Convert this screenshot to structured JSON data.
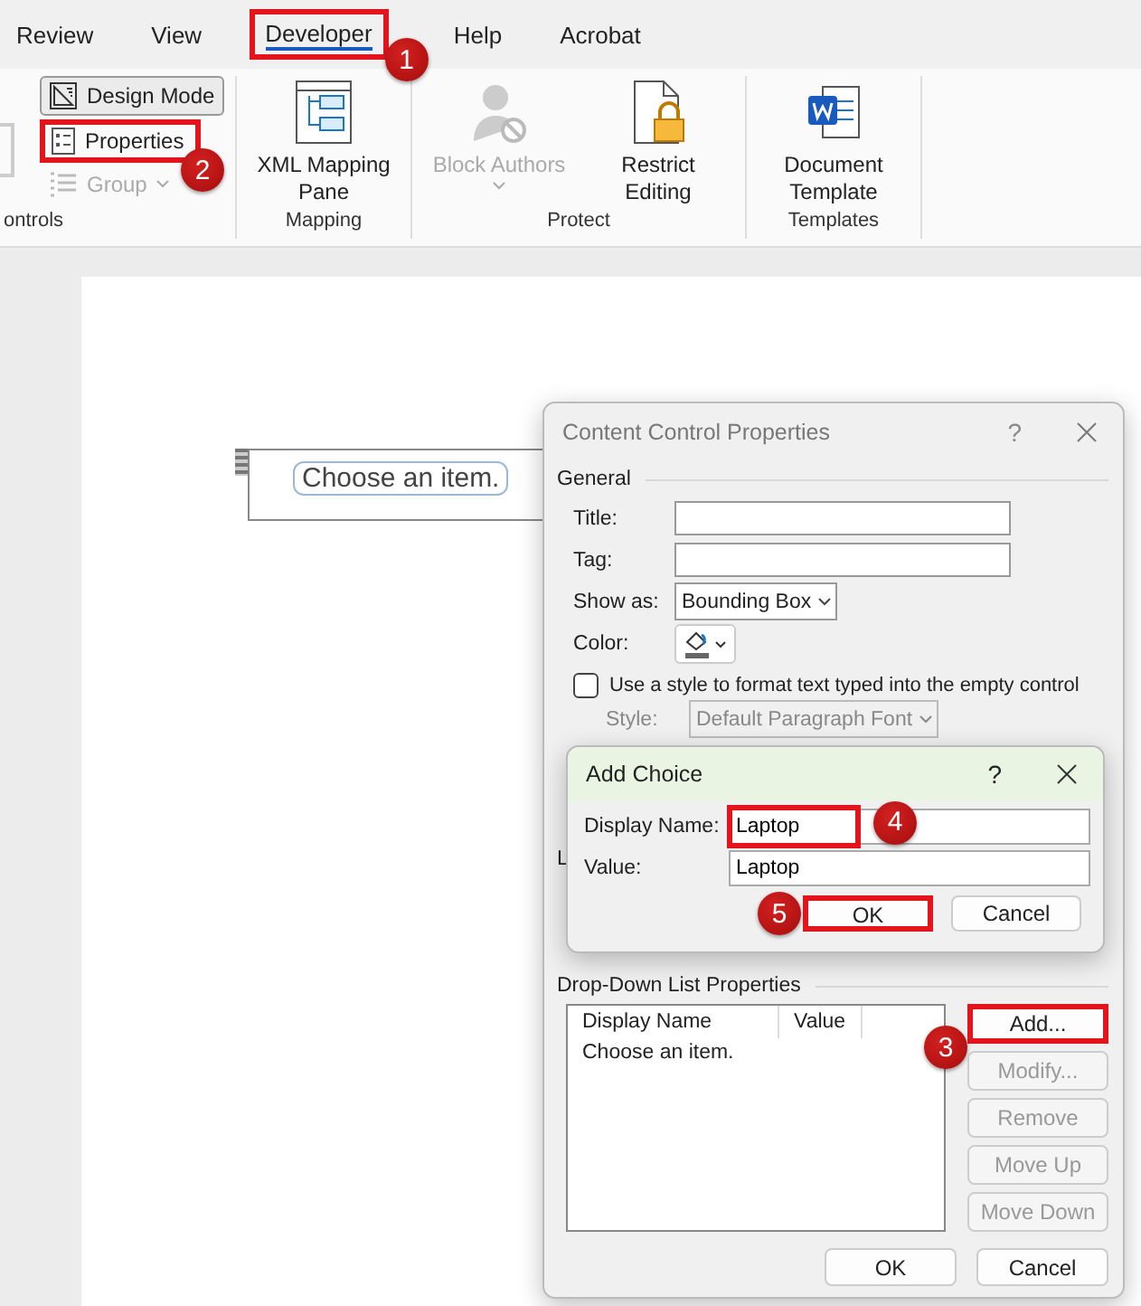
{
  "ribbon_tabs": [
    {
      "label": "Review",
      "selected": false
    },
    {
      "label": "View",
      "selected": false
    },
    {
      "label": "Developer",
      "selected": true,
      "callout": "1"
    },
    {
      "label": "Help",
      "selected": false
    },
    {
      "label": "Acrobat",
      "selected": false
    }
  ],
  "ribbon_groups": [
    {
      "label": "ontrols",
      "kind": "small",
      "buttons": [
        {
          "label": "Design Mode",
          "pressed": true,
          "disabled": false
        },
        {
          "label": "Properties",
          "pressed": false,
          "disabled": false,
          "callout": "2"
        },
        {
          "label": "Group",
          "pressed": false,
          "disabled": true,
          "dropdown": true
        }
      ]
    },
    {
      "label": "Mapping",
      "kind": "large",
      "buttons": [
        {
          "label": "XML Mapping Pane",
          "disabled": false
        }
      ]
    },
    {
      "label": "Protect",
      "kind": "large",
      "buttons": [
        {
          "label": "Block Authors",
          "disabled": true,
          "dropdown": true
        },
        {
          "label": "Restrict Editing",
          "disabled": false
        }
      ]
    },
    {
      "label": "Templates",
      "kind": "large",
      "buttons": [
        {
          "label": "Document Template",
          "disabled": false
        }
      ]
    }
  ],
  "document": {
    "content_control_text": "Choose an item."
  },
  "properties_dialog": {
    "title": "Content Control Properties",
    "help": "?",
    "general_heading": "General",
    "fields": [
      {
        "label": "Title:",
        "kind": "text"
      },
      {
        "label": "Tag:",
        "kind": "text"
      },
      {
        "label": "Show as:",
        "kind": "select",
        "value": "Bounding Box"
      },
      {
        "label": "Color:",
        "kind": "color"
      }
    ],
    "style_checkbox": {
      "label": "Use a style to format text typed into the empty control",
      "checked": false
    },
    "style_select": {
      "label": "Style:",
      "value": "Default Paragraph Font",
      "disabled": true
    },
    "locking_heading": "L",
    "dropdown_heading": "Drop-Down List Properties",
    "list": {
      "columns": [
        "Display Name",
        "Value"
      ],
      "rows": [
        "Choose an item."
      ]
    },
    "side_buttons": [
      {
        "label": "Add...",
        "disabled": false,
        "callout": "3"
      },
      {
        "label": "Modify...",
        "disabled": true
      },
      {
        "label": "Remove",
        "disabled": true
      },
      {
        "label": "Move Up",
        "disabled": true
      },
      {
        "label": "Move Down",
        "disabled": true
      }
    ],
    "footer_buttons": [
      "OK",
      "Cancel"
    ]
  },
  "add_choice_dialog": {
    "title": "Add Choice",
    "help": "?",
    "fields": [
      {
        "label": "Display Name:",
        "value": "Laptop",
        "callout": "4"
      },
      {
        "label": "Value:",
        "value": "Laptop"
      }
    ],
    "buttons": [
      {
        "label": "OK",
        "callout": "5"
      },
      {
        "label": "Cancel"
      }
    ]
  }
}
